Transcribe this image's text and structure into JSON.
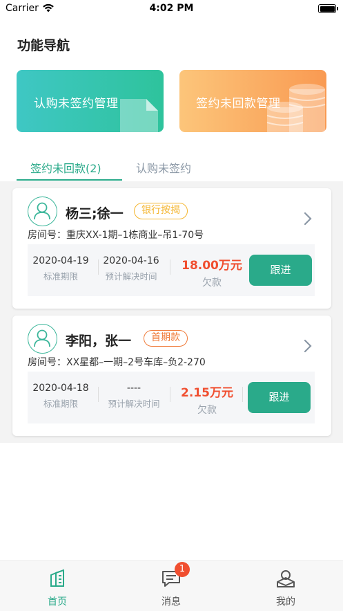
{
  "status_bar": {
    "carrier": "Carrier",
    "time": "4:02 PM"
  },
  "page_title": "功能导航",
  "nav_cards": [
    {
      "label": "认购未签约管理",
      "color": "#36c5ae"
    },
    {
      "label": "签约未回款管理",
      "color": "#f9a95f"
    }
  ],
  "tabs": [
    {
      "label": "签约未回款(2)",
      "active": true
    },
    {
      "label": "认购未签约",
      "active": false
    }
  ],
  "cards": [
    {
      "name": "杨三;徐一",
      "badge": "银行按揭",
      "room": "房间号：重庆XX-1期–1栋商业–吊1-70号",
      "standard_date": "2020-04-19",
      "standard_label": "标准期限",
      "expected_date": "2020-04-16",
      "expected_label": "预计解决时间",
      "amount": "18.00万元",
      "amount_label": "欠款",
      "button": "跟进"
    },
    {
      "name": "李阳，张一",
      "badge": "首期款",
      "room": "房间号：XX星都–一期–2号车库–负2-270",
      "standard_date": "2020-04-18",
      "standard_label": "标准期限",
      "expected_date": "----",
      "expected_label": "预计解决时间",
      "amount": "2.15万元",
      "amount_label": "欠款",
      "button": "跟进"
    }
  ],
  "tabbar": {
    "items": [
      {
        "label": "首页",
        "icon": "home-icon",
        "active": true
      },
      {
        "label": "消息",
        "icon": "message-icon",
        "active": false
      },
      {
        "label": "我的",
        "icon": "profile-icon",
        "active": false
      }
    ],
    "message_badge": "1"
  },
  "colors": {
    "accent": "#2aaa8a",
    "amount": "#f04e2f",
    "badge_yellow": "#f4b630",
    "badge_orange": "#f07b3a"
  }
}
